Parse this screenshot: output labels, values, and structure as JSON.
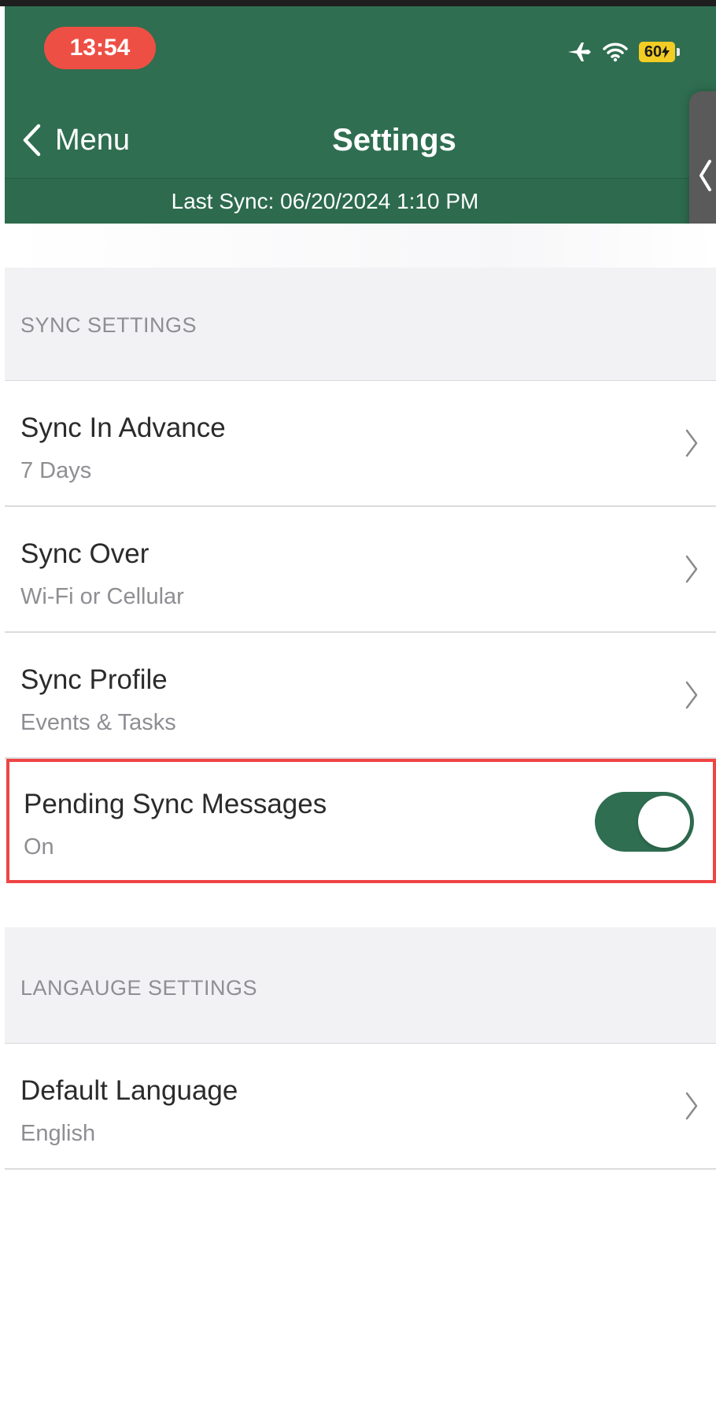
{
  "status_bar": {
    "time": "13:54",
    "battery": "60"
  },
  "nav": {
    "back_label": "Menu",
    "title": "Settings",
    "last_sync": "Last Sync: 06/20/2024 1:10 PM"
  },
  "sections": {
    "sync": {
      "header": "SYNC SETTINGS",
      "rows": [
        {
          "title": "Sync In Advance",
          "value": "7 Days"
        },
        {
          "title": "Sync Over",
          "value": "Wi-Fi or Cellular"
        },
        {
          "title": "Sync Profile",
          "value": "Events & Tasks"
        },
        {
          "title": "Pending Sync Messages",
          "value": "On",
          "toggle_on": true
        }
      ]
    },
    "language": {
      "header": "LANGAUGE SETTINGS",
      "rows": [
        {
          "title": "Default Language",
          "value": "English"
        }
      ]
    }
  },
  "colors": {
    "brand_green": "#2f6e51",
    "time_pill": "#ee4f45",
    "battery": "#f3cd23",
    "highlight": "#ef4444"
  },
  "icons": {
    "back": "chevron-left-icon",
    "airplane": "airplane-icon",
    "wifi": "wifi-icon",
    "charging": "bolt-icon",
    "row_disclosure": "chevron-right-icon",
    "side_handle": "chevron-left-icon"
  }
}
